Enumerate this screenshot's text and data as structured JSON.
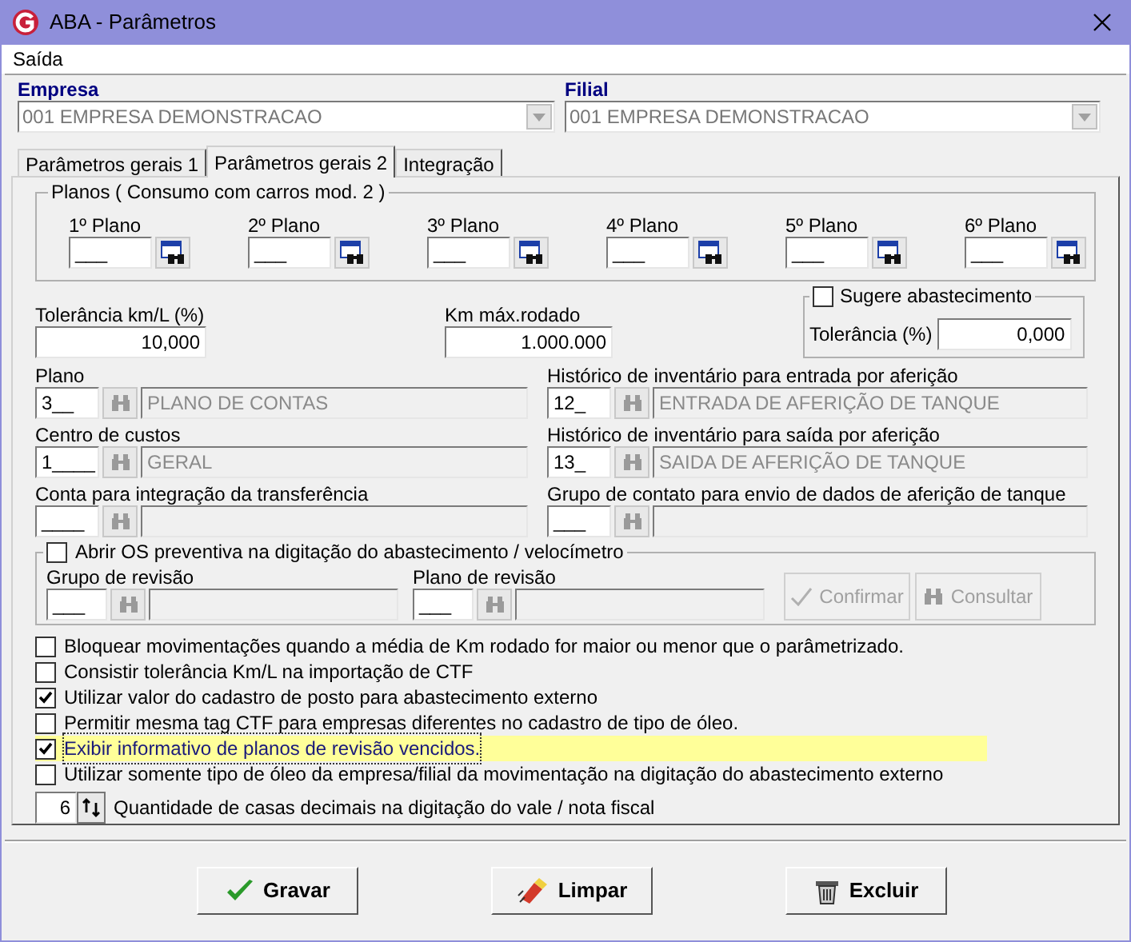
{
  "window": {
    "title": "ABA - Parâmetros"
  },
  "menu": [
    "Saída"
  ],
  "empresa": {
    "label": "Empresa",
    "value": "001 EMPRESA DEMONSTRACAO",
    "disabled": true
  },
  "filial": {
    "label": "Filial",
    "value": "001 EMPRESA DEMONSTRACAO",
    "disabled": true
  },
  "tabs": [
    {
      "label": "Parâmetros gerais 1",
      "selected": false
    },
    {
      "label": "Parâmetros gerais 2",
      "selected": true
    },
    {
      "label": "Integração",
      "selected": false
    }
  ],
  "planos": {
    "title": "Planos ( Consumo com carros mod. 2 )",
    "items": [
      {
        "label": "1º Plano",
        "value": "___"
      },
      {
        "label": "2º Plano",
        "value": "___"
      },
      {
        "label": "3º Plano",
        "value": "___"
      },
      {
        "label": "4º Plano",
        "value": "___"
      },
      {
        "label": "5º Plano",
        "value": "___"
      },
      {
        "label": "6º Plano",
        "value": "___"
      }
    ]
  },
  "tolerancia": {
    "label": "Tolerância km/L (%)",
    "value": "10,000"
  },
  "km_max": {
    "label": "Km máx.rodado",
    "value": "1.000.000"
  },
  "sugere": {
    "label": "Sugere abastecimento",
    "checked": false,
    "tolerance_label": "Tolerância (%)",
    "tolerance_value": "0,000"
  },
  "lookups": [
    {
      "label": "Plano",
      "code": "3__",
      "description": "PLANO DE CONTAS"
    },
    {
      "label": "Histórico de inventário para entrada por aferição",
      "code": "12_",
      "description": "ENTRADA DE AFERIÇÃO DE TANQUE"
    },
    {
      "label": "Centro de custos",
      "code": "1____",
      "description": "GERAL"
    },
    {
      "label": "Histórico de inventário para saída por aferição",
      "code": "13_",
      "description": "SAIDA DE AFERIÇÃO DE TANQUE"
    },
    {
      "label": "Conta para integração da transferência",
      "code": "____"
    },
    {
      "label": "Grupo de contato para envio de dados de aferição de tanque",
      "code": "___"
    }
  ],
  "os_preventiva": {
    "label": "Abrir OS preventiva na digitação do abastecimento / velocímetro",
    "checked": false,
    "fields": [
      {
        "label": "Grupo de revisão",
        "code": "___"
      },
      {
        "label": "Plano de revisão",
        "code": "___"
      }
    ],
    "buttons": [
      {
        "label": "Confirmar",
        "kind": "confirm",
        "disabled": true
      },
      {
        "label": "Consultar",
        "kind": "search",
        "disabled": true
      }
    ]
  },
  "options": [
    {
      "label": "Bloquear movimentações quando a média de Km rodado for maior ou menor que o parâmetrizado.",
      "checked": false,
      "highlighted": false
    },
    {
      "label": "Consistir tolerância Km/L na importação de CTF",
      "checked": false,
      "highlighted": false
    },
    {
      "label": "Utilizar valor do cadastro de posto para abastecimento externo",
      "checked": true,
      "highlighted": false
    },
    {
      "label": "Permitir mesma tag CTF para empresas diferentes no cadastro de tipo de óleo.",
      "checked": false,
      "highlighted": false
    },
    {
      "label": "Exibir informativo de planos de revisão vencidos.",
      "checked": true,
      "highlighted": true
    },
    {
      "label": "Utilizar somente tipo de óleo da empresa/filial da movimentação na digitação do abastecimento externo",
      "checked": false,
      "highlighted": false
    }
  ],
  "decimals": {
    "value": "6",
    "label": "Quantidade de casas decimais na digitação do vale / nota fiscal"
  },
  "buttons": [
    {
      "label": "Gravar",
      "kind": "save"
    },
    {
      "label": "Limpar",
      "kind": "clear"
    },
    {
      "label": "Excluir",
      "kind": "delete"
    }
  ]
}
